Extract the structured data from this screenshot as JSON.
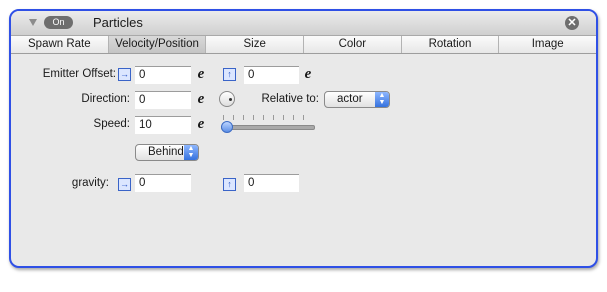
{
  "panel": {
    "toggle_label": "On",
    "title": "Particles",
    "close_glyph": "✕",
    "accent_color": "#2f50e6"
  },
  "tabs": [
    {
      "label": "Spawn Rate",
      "active": false
    },
    {
      "label": "Velocity/Position",
      "active": true
    },
    {
      "label": "Size",
      "active": false
    },
    {
      "label": "Color",
      "active": false
    },
    {
      "label": "Rotation",
      "active": false
    },
    {
      "label": "Image",
      "active": false
    }
  ],
  "form": {
    "emitter_offset": {
      "label": "Emitter Offset:",
      "x_value": "0",
      "y_value": "0"
    },
    "direction": {
      "label": "Direction:",
      "value": "0",
      "relative_label": "Relative to:",
      "relative_value": "actor"
    },
    "speed": {
      "label": "Speed:",
      "value": "10",
      "slider_level": 0
    },
    "layer": {
      "value": "Behind"
    },
    "gravity": {
      "label": "gravity:",
      "x_value": "0",
      "y_value": "0"
    }
  },
  "icons": {
    "expression": "e",
    "x_axis": "→",
    "y_axis": "↑",
    "popup_up": "▲",
    "popup_down": "▼"
  }
}
